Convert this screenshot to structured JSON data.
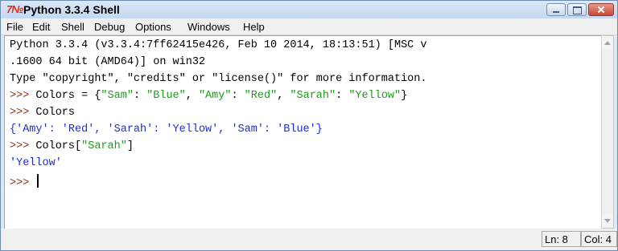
{
  "window": {
    "title": "Python 3.3.4 Shell",
    "icon": "python-idle-icon",
    "icon_text": "7№"
  },
  "menu": [
    "File",
    "Edit",
    "Shell",
    "Debug",
    "Options",
    "Windows",
    "Help"
  ],
  "console": {
    "banner1": "Python 3.3.4 (v3.3.4:7ff62415e426, Feb 10 2014, 18:13:51) [MSC v",
    "banner2": ".1600 64 bit (AMD64)] on win32",
    "banner3": "Type \"copyright\", \"credits\" or \"license()\" for more information.",
    "prompt": ">>> ",
    "cmd1_code": "Colors = {",
    "cmd1_s1": "\"Sam\"",
    "cmd1_p1": ": ",
    "cmd1_s2": "\"Blue\"",
    "cmd1_p2": ", ",
    "cmd1_s3": "\"Amy\"",
    "cmd1_p3": ": ",
    "cmd1_s4": "\"Red\"",
    "cmd1_p4": ", ",
    "cmd1_s5": "\"Sarah\"",
    "cmd1_p5": ": ",
    "cmd1_s6": "\"Yellow\"",
    "cmd1_end": "}",
    "cmd2": "Colors",
    "out2": "{'Amy': 'Red', 'Sarah': 'Yellow', 'Sam': 'Blue'}",
    "cmd3_code": "Colors[",
    "cmd3_str": "\"Sarah\"",
    "cmd3_end": "]",
    "out3": "'Yellow'"
  },
  "status": {
    "line": "Ln: 8",
    "col": "Col: 4"
  },
  "colors": {
    "prompt": "#9b2a1a",
    "string": "#1a9e1a",
    "output": "#1f2bd1",
    "close_button": "#c8483a"
  }
}
